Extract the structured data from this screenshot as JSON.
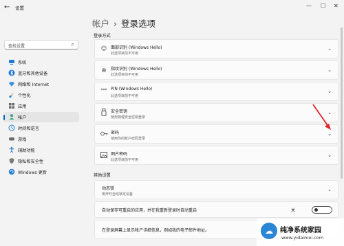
{
  "app": {
    "title": "设置"
  },
  "search": {
    "placeholder": "查找设置"
  },
  "nav": [
    {
      "label": "系统",
      "icon": "system-icon",
      "selected": false
    },
    {
      "label": "蓝牙和其他设备",
      "icon": "bluetooth-icon",
      "selected": false
    },
    {
      "label": "网络和 Internet",
      "icon": "network-icon",
      "selected": false
    },
    {
      "label": "个性化",
      "icon": "brush-icon",
      "selected": false
    },
    {
      "label": "应用",
      "icon": "apps-icon",
      "selected": false
    },
    {
      "label": "帐户",
      "icon": "person-icon",
      "selected": true
    },
    {
      "label": "时间和语言",
      "icon": "globe-clock-icon",
      "selected": false
    },
    {
      "label": "游戏",
      "icon": "game-icon",
      "selected": false
    },
    {
      "label": "辅助功能",
      "icon": "accessibility-icon",
      "selected": false
    },
    {
      "label": "隐私和安全性",
      "icon": "shield-icon",
      "selected": false
    },
    {
      "label": "Windows 更新",
      "icon": "update-icon",
      "selected": false
    }
  ],
  "header": {
    "parent": "帐户",
    "title": "登录选项"
  },
  "sections": {
    "signin_methods": "登录方式",
    "other": "其他设置"
  },
  "methods": [
    {
      "title": "面部识别 (Windows Hello)",
      "subtitle": "此选项目前不可用",
      "icon": "face-icon"
    },
    {
      "title": "指纹识别 (Windows Hello)",
      "subtitle": "此选项目前不可用",
      "icon": "fingerprint-icon"
    },
    {
      "title": "PIN (Windows Hello)",
      "subtitle": "此选项目前不可用",
      "icon": "pin-icon"
    },
    {
      "title": "安全密钥",
      "subtitle": "使用物理安全密钥登录",
      "icon": "usb-key-icon"
    },
    {
      "title": "密码",
      "subtitle": "使用你的帐户密码登录",
      "icon": "key-icon"
    },
    {
      "title": "图片密码",
      "subtitle": "此选项目前不可用",
      "icon": "picture-icon"
    }
  ],
  "other": {
    "dynamic_lock": {
      "title": "动态锁",
      "subtitle": "离开时自动锁定设备"
    },
    "auto_restart": {
      "label": "自动保存可重启的应用，并在我重新登录时自动重启",
      "toggle_state": "关",
      "on": false
    },
    "account_details": {
      "label": "在登录屏幕上显示帐户详细信息，例如我的电子邮件地址。"
    }
  },
  "watermark": {
    "title": "纯净系统家园",
    "url": "www.yidaimei.com"
  },
  "colors": {
    "accent": "#0067c0",
    "annotation_arrow": "#e0202a"
  }
}
